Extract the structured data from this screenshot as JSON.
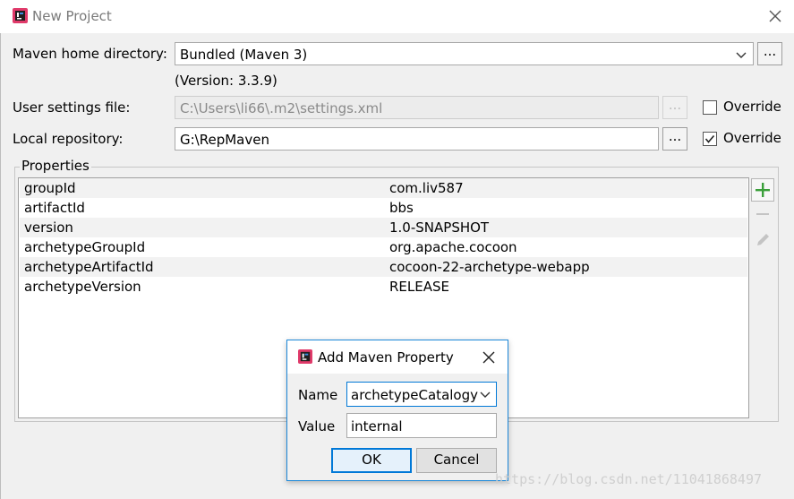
{
  "window": {
    "title": "New Project",
    "icon": "intellij-logo-icon"
  },
  "form": {
    "maven_home": {
      "label": "Maven home directory:",
      "value": "Bundled (Maven 3)",
      "version_note": "(Version: 3.3.9)",
      "browse_label": "..."
    },
    "user_settings": {
      "label": "User settings file:",
      "value": "C:\\Users\\li66\\.m2\\settings.xml",
      "browse_label": "...",
      "override_label": "Override",
      "override_checked": false
    },
    "local_repo": {
      "label": "Local repository:",
      "value": "G:\\RepMaven",
      "browse_label": "...",
      "override_label": "Override",
      "override_checked": true
    }
  },
  "properties": {
    "legend": "Properties",
    "rows": [
      {
        "key": "groupId",
        "value": "com.liv587"
      },
      {
        "key": "artifactId",
        "value": "bbs"
      },
      {
        "key": "version",
        "value": "1.0-SNAPSHOT"
      },
      {
        "key": "archetypeGroupId",
        "value": "org.apache.cocoon"
      },
      {
        "key": "archetypeArtifactId",
        "value": "cocoon-22-archetype-webapp"
      },
      {
        "key": "archetypeVersion",
        "value": "RELEASE"
      }
    ],
    "toolbar": [
      "add-icon",
      "remove-icon",
      "edit-icon"
    ]
  },
  "dialog": {
    "title": "Add Maven Property",
    "name_label": "Name",
    "name_value": "archetypeCatalogy",
    "value_label": "Value",
    "value_value": "internal",
    "ok_label": "OK",
    "cancel_label": "Cancel"
  },
  "watermark": "https://blog.csdn.net/11041868497",
  "colors": {
    "accent": "#0078d7",
    "add_green": "#3a9f3a",
    "panel_bg": "#f0f0f0"
  }
}
